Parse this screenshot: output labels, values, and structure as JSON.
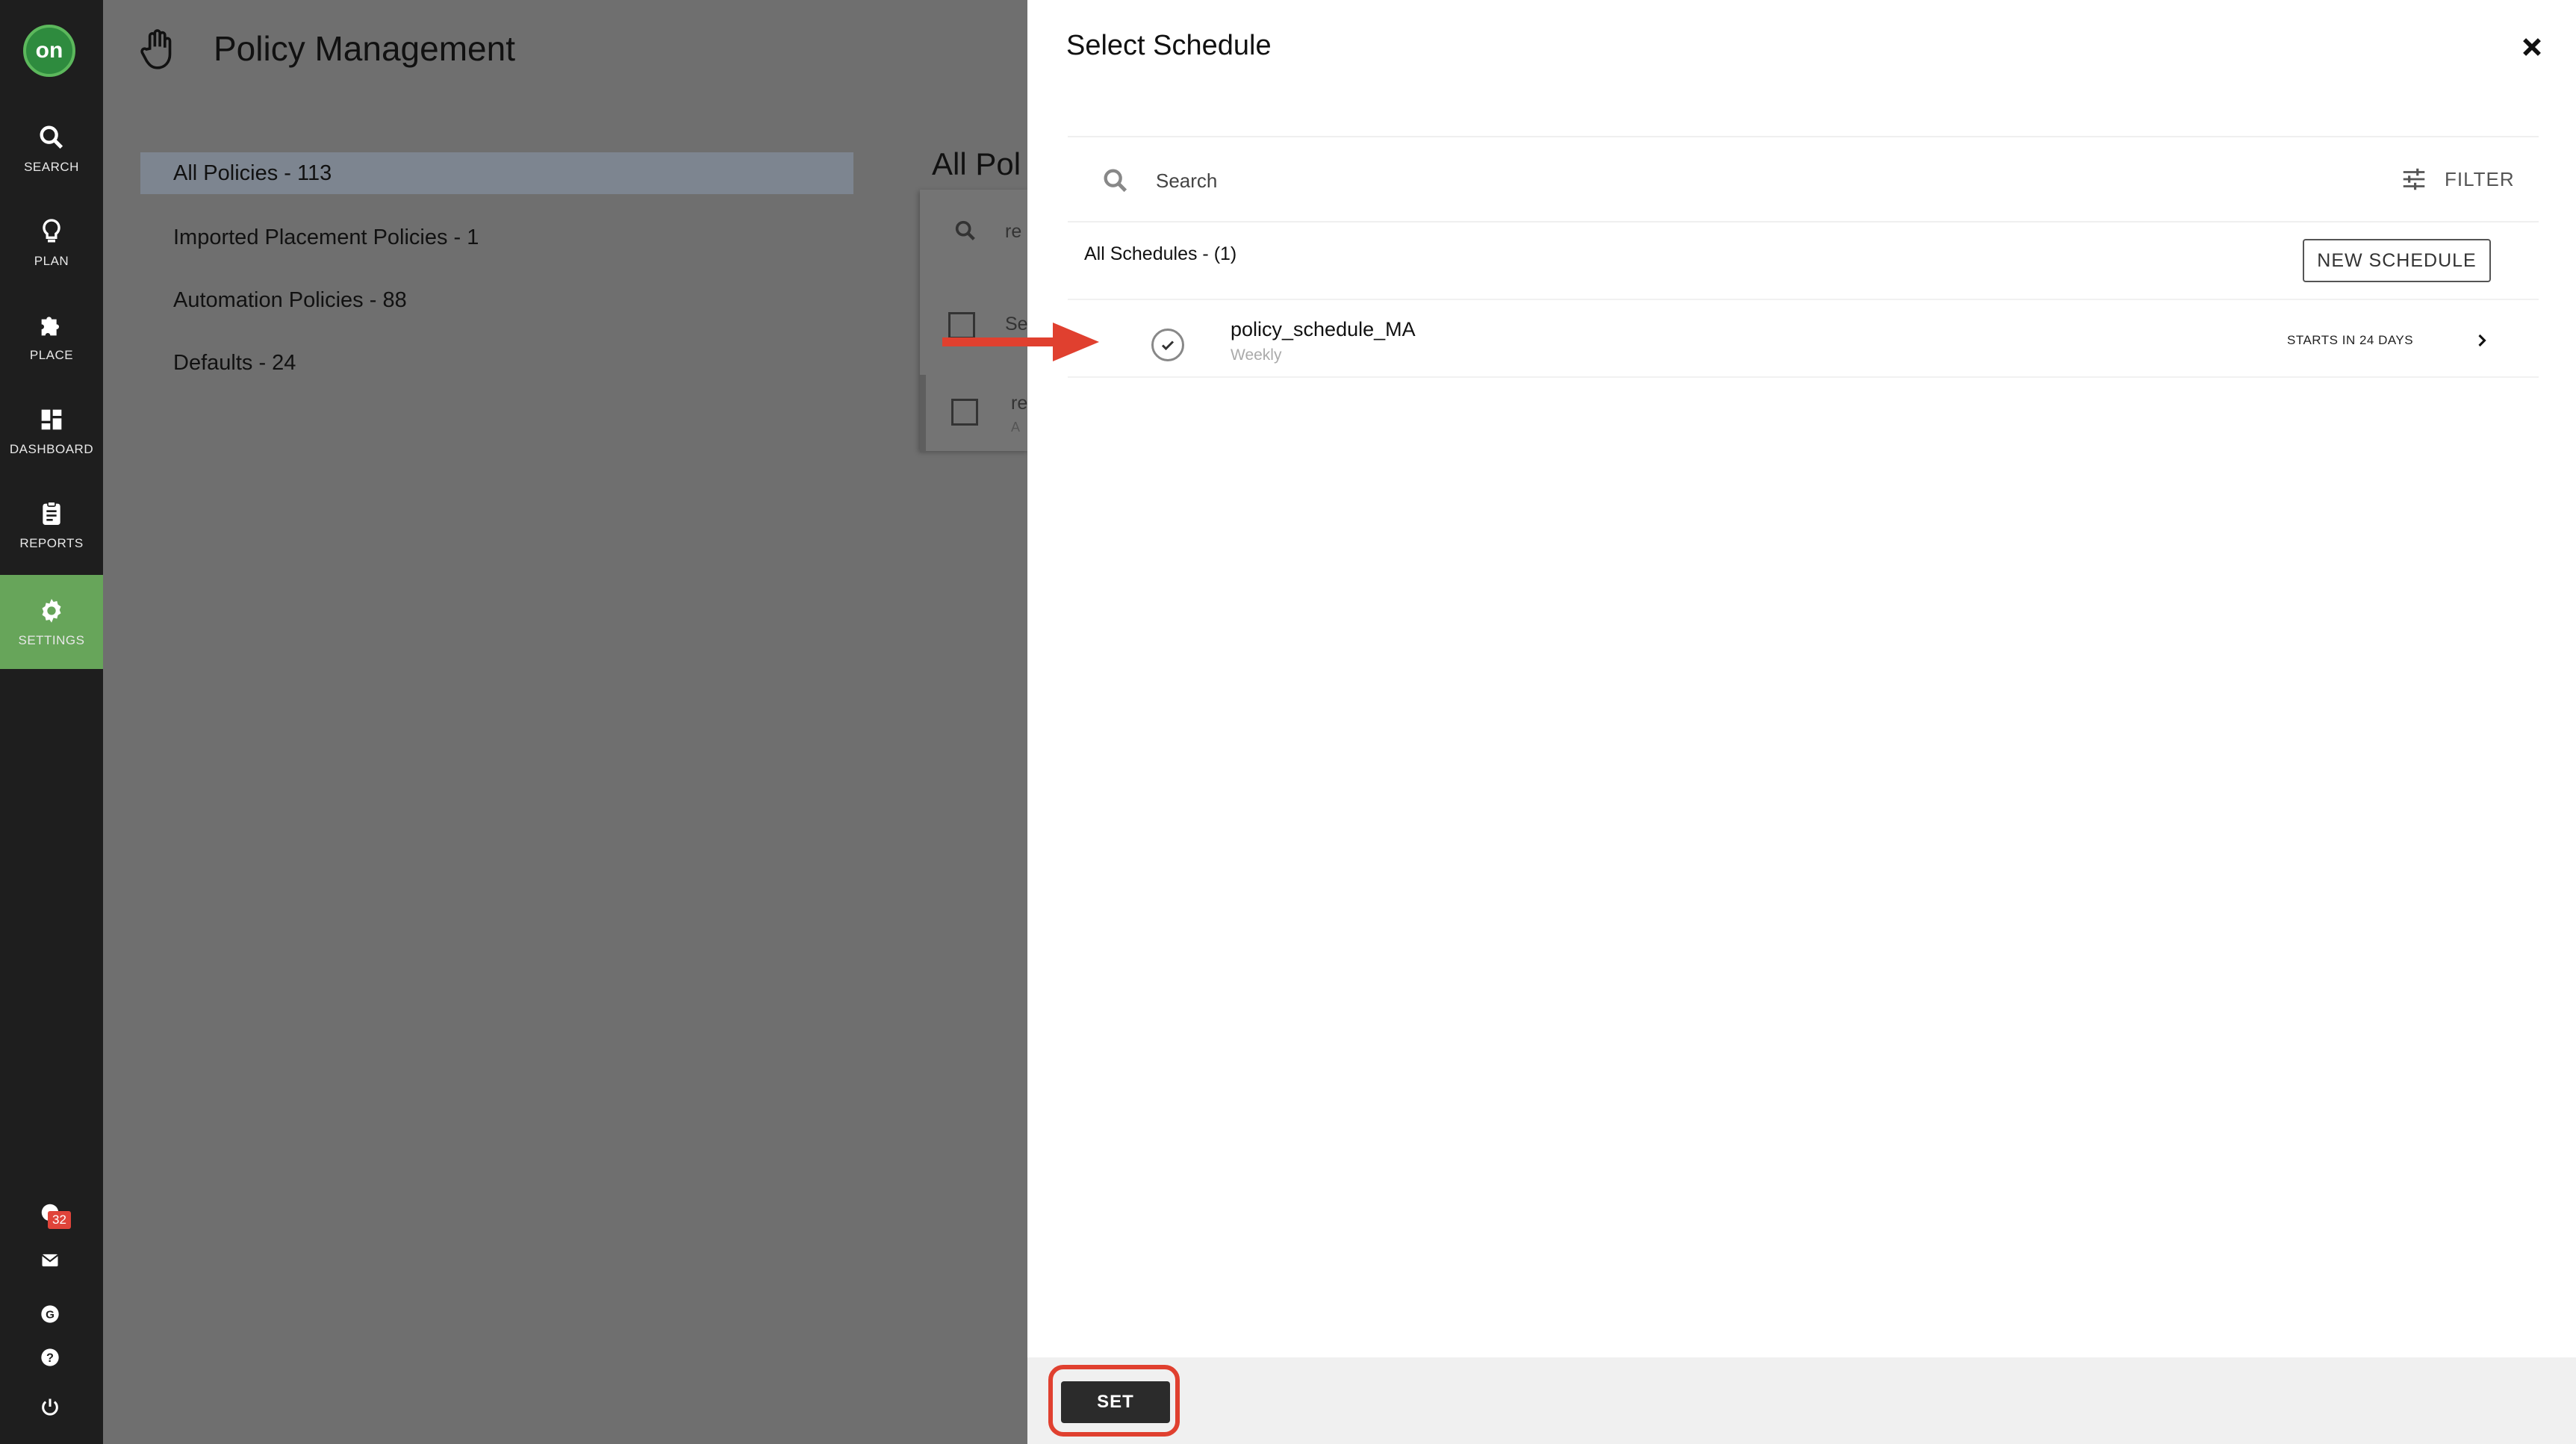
{
  "nav": {
    "logo": "on",
    "items": [
      {
        "label": "SEARCH",
        "icon": "search-icon"
      },
      {
        "label": "PLAN",
        "icon": "lightbulb-icon"
      },
      {
        "label": "PLACE",
        "icon": "puzzle-icon"
      },
      {
        "label": "DASHBOARD",
        "icon": "dashboard-icon"
      },
      {
        "label": "REPORTS",
        "icon": "clipboard-icon"
      },
      {
        "label": "SETTINGS",
        "icon": "gear-icon"
      }
    ],
    "notification_count": "32",
    "active_color": "#67a55a"
  },
  "page": {
    "title": "Policy Management",
    "menu": [
      "All Policies - 113",
      "Imported Placement Policies - 1",
      "Automation Policies - 88",
      "Defaults - 24"
    ],
    "section_title": "All Pol",
    "search_partial": "re",
    "row1_partial": "Se",
    "row2_partial": "re",
    "row2_sub_partial": "A"
  },
  "modal": {
    "title": "Select Schedule",
    "search_placeholder": "Search",
    "filter_label": "FILTER",
    "list_heading": "All Schedules - (1)",
    "new_schedule_label": "NEW SCHEDULE",
    "schedules": [
      {
        "name": "policy_schedule_MA",
        "frequency": "Weekly",
        "starts": "STARTS IN 24 DAYS",
        "selected": true
      }
    ],
    "set_label": "SET",
    "highlight_color": "#e0402f"
  }
}
